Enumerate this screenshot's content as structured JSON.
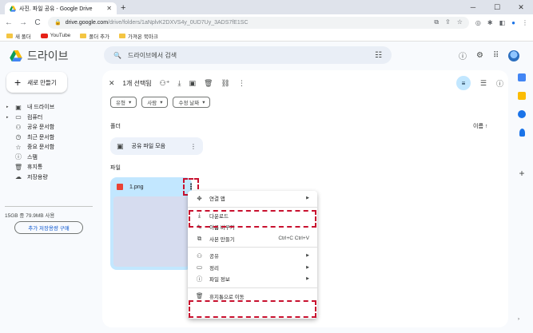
{
  "browser": {
    "tab_title": "사진. 파일 공유 - Google Drive",
    "tab_close": "✕",
    "new_tab": "+",
    "win_min": "─",
    "win_max": "☐",
    "win_close": "✕",
    "back": "←",
    "forward": "→",
    "reload": "C",
    "url_host": "drive.google.com",
    "url_path": "/drive/folders/1aNplvK2DXVS4y_0UD7Uy_3ADS7fE1SC",
    "bookmarks": [
      {
        "label": "새 폴더"
      },
      {
        "label": "YouTube"
      },
      {
        "label": "폴더 추가"
      },
      {
        "label": "가져온 북마크"
      }
    ]
  },
  "drive": {
    "logo_text": "드라이브",
    "search_placeholder": "드라이브에서 검색",
    "new_button": "새로 만들기",
    "sidebar": [
      {
        "label": "내 드라이브",
        "icon": "▣",
        "arrow": "▸"
      },
      {
        "label": "컴퓨터",
        "icon": "▭",
        "arrow": "▸"
      },
      {
        "label": "공유 문서함",
        "icon": "⚇",
        "arrow": ""
      },
      {
        "label": "최근 문서함",
        "icon": "◷",
        "arrow": ""
      },
      {
        "label": "중요 문서함",
        "icon": "☆",
        "arrow": ""
      },
      {
        "label": "스팸",
        "icon": "ⓘ",
        "arrow": ""
      },
      {
        "label": "휴지통",
        "icon": "🗑",
        "arrow": ""
      },
      {
        "label": "저장용량",
        "icon": "☁",
        "arrow": ""
      }
    ],
    "storage_text": "15GB 중 79.9MB 사용",
    "buy_storage": "추가 저장용량 구매",
    "selection_count": "1개 선택됨",
    "chips": [
      "유형",
      "사람",
      "수정 날짜"
    ],
    "section_folders": "폴더",
    "sort_label": "이름",
    "sort_arrow": "↑",
    "folder_name": "공유 파일 모음",
    "section_files": "파일",
    "file_name": "1.png",
    "context_menu": {
      "open_with": "연결 앱",
      "download": "다운로드",
      "rename": "이름 바꾸기",
      "copy": "사본 만들기",
      "copy_shortcut": "Ctrl+C Ctrl+V",
      "share": "공유",
      "organize": "정리",
      "file_info": "파일 정보",
      "trash": "휴지통으로 이동"
    }
  },
  "colors": {
    "highlight": "#c8102e",
    "selected_card": "#c2e7ff"
  }
}
